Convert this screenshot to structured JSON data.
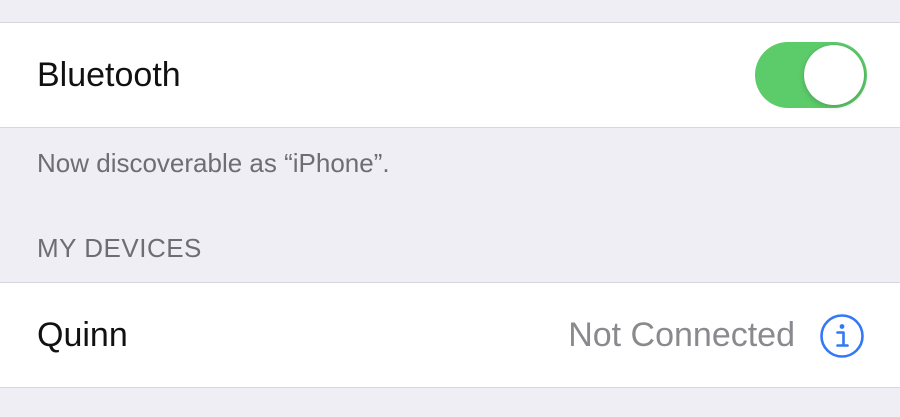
{
  "bluetooth": {
    "label": "Bluetooth",
    "enabled": true,
    "toggle_color": "#5ccb6a"
  },
  "discoverable_note": "Now discoverable as “iPhone”.",
  "my_devices": {
    "header": "MY DEVICES",
    "devices": [
      {
        "name": "Quinn",
        "status": "Not Connected",
        "icon": "info-icon"
      }
    ]
  },
  "colors": {
    "background": "#efeef4",
    "cell": "#ffffff",
    "accent": "#3478f6",
    "secondary_text": "#8a8a8e"
  }
}
